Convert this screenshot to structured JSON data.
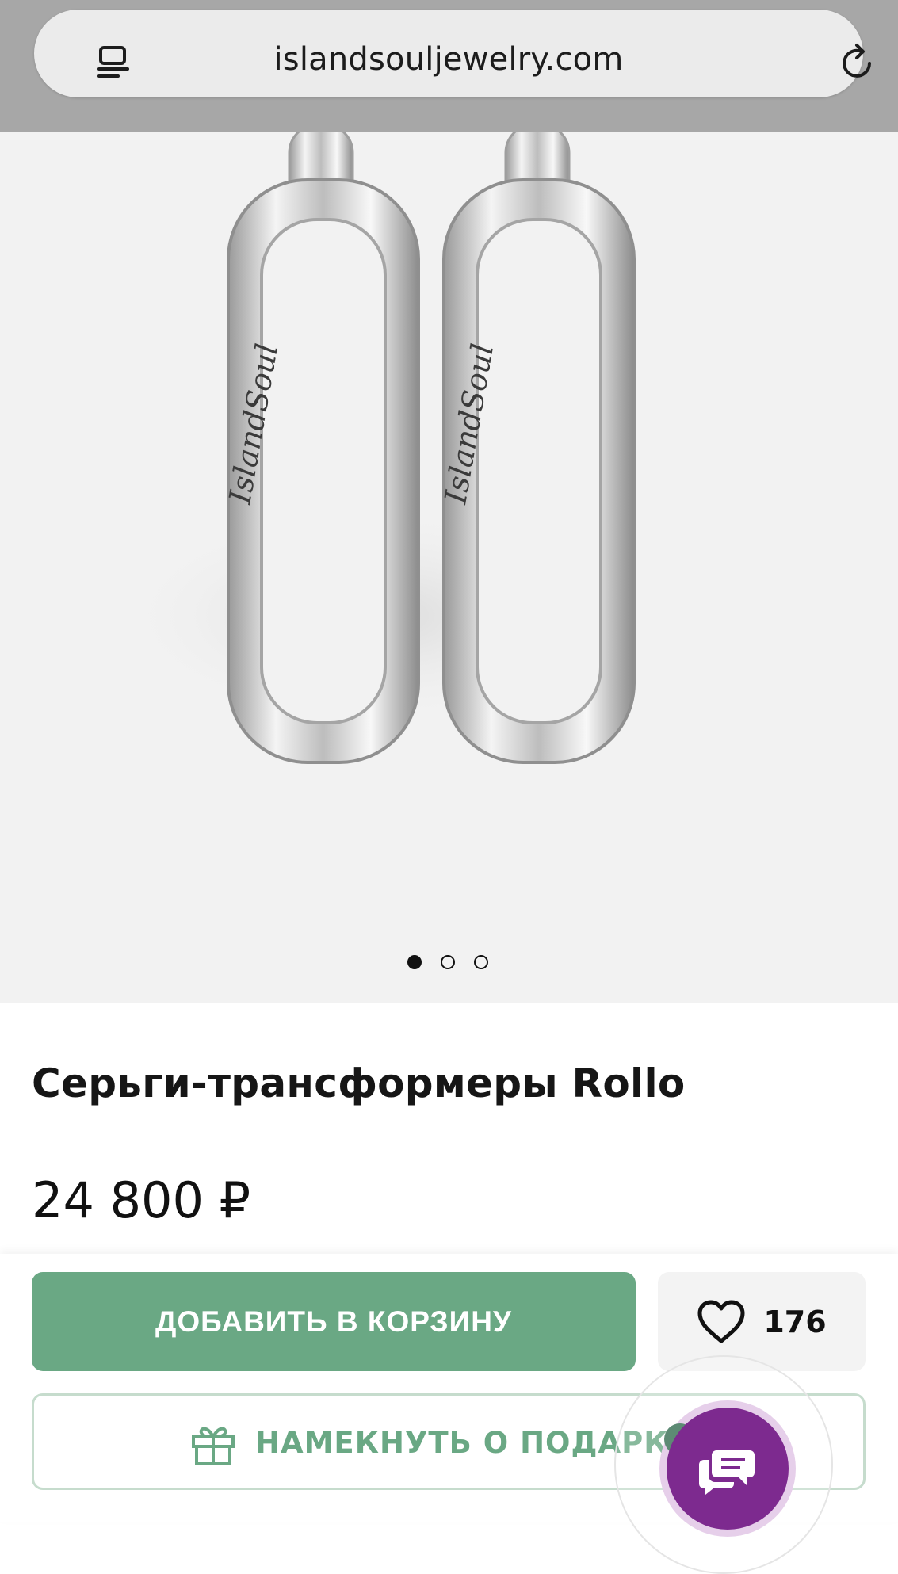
{
  "browser": {
    "url": "islandsouljewelry.com",
    "icons": {
      "reader": "reader-mode-icon",
      "reload": "reload-icon"
    }
  },
  "gallery": {
    "image": "Rollo silver transformer earrings photo",
    "engraving_text": "IslandSoul",
    "slides_total": 3,
    "active_slide": 1
  },
  "product": {
    "title": "Серьги-трансформеры Rollo",
    "price": "24 800 ₽"
  },
  "actions": {
    "add_to_cart_label": "ДОБАВИТЬ В КОРЗИНУ",
    "wishlist_count": "176",
    "gift_hint_label": "НАМЕКНУТЬ О ПОДАРКЕ",
    "icons": {
      "wishlist": "heart-icon",
      "gift": "gift-icon",
      "chat": "chat-icon"
    }
  },
  "colors": {
    "accent_green": "#6aa884",
    "chat_purple": "#7d2a8f",
    "browser_bar": "#a7a7a7"
  }
}
